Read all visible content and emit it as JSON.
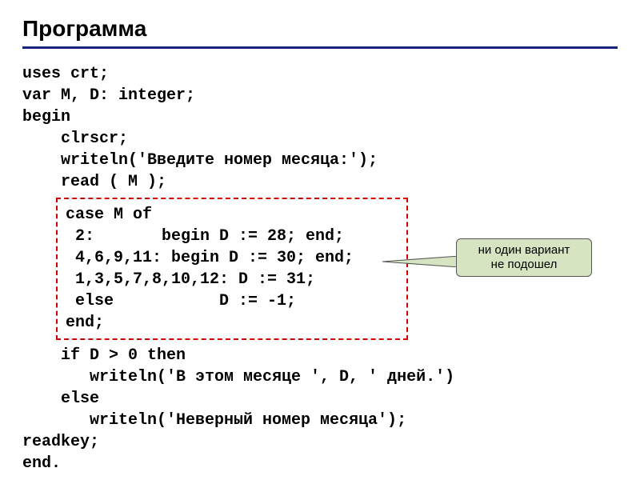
{
  "title": "Программа",
  "code": {
    "l1": "uses crt;",
    "l2": "var M, D: integer;",
    "l3": "begin",
    "l4": "clrscr;",
    "l5": "writeln('Введите номер месяца:');",
    "l6": "read ( M );",
    "case": {
      "l1": "case M of",
      "l2": " 2:       begin D := 28; end;",
      "l3": " 4,6,9,11: begin D := 30; end;",
      "l4": " 1,3,5,7,8,10,12: D := 31;",
      "l5": " else           D := -1;",
      "l6": "end;"
    },
    "l7": "if D > 0 then",
    "l8": "writeln('В этом месяце ', D, ' дней.')",
    "l9": "else",
    "l10": "writeln('Неверный номер месяца');",
    "l11": "readkey;",
    "l12": "end."
  },
  "callout": {
    "line1": "ни один вариант",
    "line2": "не подошел"
  }
}
